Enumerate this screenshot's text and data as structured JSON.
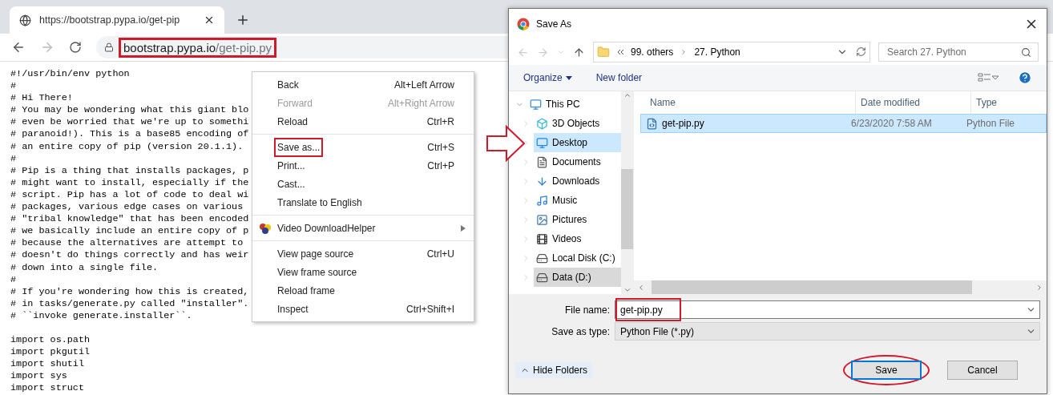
{
  "browser": {
    "tab": {
      "title": "https://bootstrap.pypa.io/get-pip"
    },
    "address": {
      "host": "bootstrap.pypa.io",
      "path": "/get-pip.py",
      "highlighted": true
    }
  },
  "comment_lines": [
    "#!/usr/bin/env python",
    "#",
    "# Hi There!",
    "# You may be wondering what this giant blo",
    "# even be worried that we're up to somethi",
    "# paranoid!). This is a base85 encoding of",
    "# an entire copy of pip (version 20.1.1).",
    "#",
    "# Pip is a thing that installs packages, p",
    "# might want to install, especially if the",
    "# script. Pip has a lot of code to deal wi",
    "# packages, various edge cases on various",
    "# \"tribal knowledge\" that has been encoded",
    "# we basically include an entire copy of p",
    "# because the alternatives are attempt to",
    "# doesn't do things correctly and has weir",
    "# down into a single file.",
    "#",
    "# If you're wondering how this is created,",
    "# in tasks/generate.py called \"installer\".",
    "# ``invoke generate.installer``."
  ],
  "import_lines": [
    "import os.path",
    "import pkgutil",
    "import shutil",
    "import sys",
    "import struct"
  ],
  "context_menu": [
    [
      {
        "kind": "plain",
        "label": "Back",
        "shortcut": "Alt+Left Arrow",
        "disabled": false
      },
      {
        "kind": "plain",
        "label": "Forward",
        "shortcut": "Alt+Right Arrow",
        "disabled": true
      },
      {
        "kind": "plain",
        "label": "Reload",
        "shortcut": "Ctrl+R",
        "disabled": false
      }
    ],
    [
      {
        "kind": "plain",
        "label": "Save as...",
        "shortcut": "Ctrl+S",
        "disabled": false,
        "highlighted": true
      },
      {
        "kind": "plain",
        "label": "Print...",
        "shortcut": "Ctrl+P",
        "disabled": false
      },
      {
        "kind": "plain",
        "label": "Cast...",
        "disabled": false
      },
      {
        "kind": "plain",
        "label": "Translate to English",
        "disabled": false
      }
    ],
    [
      {
        "kind": "submenu",
        "label": "Video DownloadHelper",
        "disabled": false
      }
    ],
    [
      {
        "kind": "plain",
        "label": "View page source",
        "shortcut": "Ctrl+U",
        "disabled": false
      },
      {
        "kind": "plain",
        "label": "View frame source",
        "disabled": false
      },
      {
        "kind": "plain",
        "label": "Reload frame",
        "disabled": false
      },
      {
        "kind": "plain",
        "label": "Inspect",
        "shortcut": "Ctrl+Shift+I",
        "disabled": false
      }
    ]
  ],
  "dialog": {
    "title": "Save As",
    "path": [
      "99. others",
      "27. Python"
    ],
    "search": {
      "placeholder": "Search 27. Python"
    },
    "toolbar": [
      "Organize",
      "New folder"
    ],
    "nav": [
      {
        "kind": "pc",
        "label": "This PC",
        "expanded": true,
        "selected": false,
        "children": [
          {
            "kind": "cube",
            "label": "3D Objects",
            "selected": false
          },
          {
            "kind": "desktop",
            "label": "Desktop",
            "selected": true
          },
          {
            "kind": "documents",
            "label": "Documents",
            "selected": false
          },
          {
            "kind": "downloads",
            "label": "Downloads",
            "selected": false
          },
          {
            "kind": "music",
            "label": "Music",
            "selected": false
          },
          {
            "kind": "pictures",
            "label": "Pictures",
            "selected": false
          },
          {
            "kind": "videos",
            "label": "Videos",
            "selected": false
          },
          {
            "kind": "disk",
            "label": "Local Disk (C:)",
            "selected": false
          },
          {
            "kind": "drive",
            "label": "Data (D:)",
            "selected": false,
            "hovered": true
          }
        ]
      }
    ],
    "columns": [
      "Name",
      "Date modified",
      "Type"
    ],
    "files": [
      {
        "name": "get-pip.py",
        "date": "6/23/2020 7:58 AM",
        "type": "Python File",
        "selected": true
      }
    ],
    "file_name": {
      "label": "File name:",
      "value": "get-pip.py",
      "highlighted": true
    },
    "save_type": {
      "label": "Save as type:",
      "value": "Python File (*.py)"
    },
    "hide_folders": "Hide Folders",
    "buttons": [
      {
        "label": "Save",
        "default": true,
        "highlighted": true
      },
      {
        "label": "Cancel",
        "default": false,
        "highlighted": false
      }
    ]
  }
}
